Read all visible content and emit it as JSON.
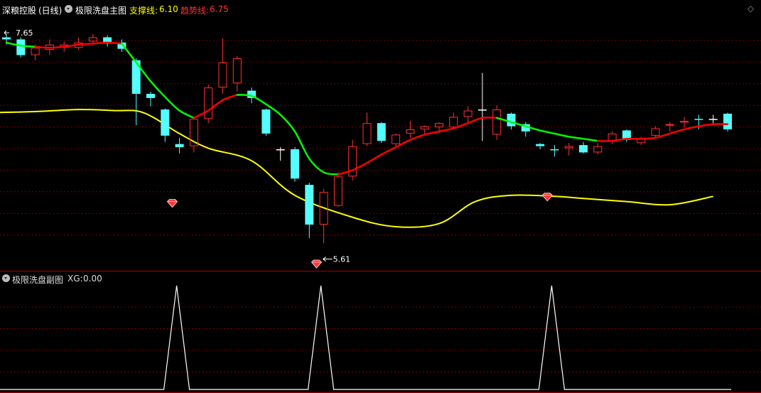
{
  "header": {
    "stock_name": "深粮控股",
    "period": "(日线)",
    "indicator_name": "极限洗盘主图",
    "support_label": "支撑线:",
    "support_value": "6.10",
    "trend_label": "趋势线:",
    "trend_value": "6.75"
  },
  "sub_header": {
    "indicator_name": "极限洗盘副图",
    "xg_label": "XG:",
    "xg_value": "0.00"
  },
  "icons": [
    "dropdown-circle-icon",
    "diamond-icon",
    "gem-marker-icon"
  ],
  "colors": {
    "background": "#000000",
    "grid": "#7a0000",
    "up_candle": "#ff3232",
    "down_candle": "#54ffff",
    "doji": "#ffffff",
    "support_line": "#ffff00",
    "trend_up": "#ff0000",
    "trend_down": "#00ff00",
    "signal_line": "#ffffff",
    "support_label": "#ffff00",
    "trend_label": "#ff3232"
  },
  "chart_data": [
    {
      "type": "candlestick",
      "name": "main",
      "ylim": [
        5.45,
        7.8
      ],
      "high_annotation": {
        "label": "7.65",
        "index": 0
      },
      "low_annotation": {
        "label": "5.61",
        "index": 22
      },
      "candles": [
        [
          7.62,
          7.6,
          7.65,
          7.55
        ],
        [
          7.6,
          7.45,
          7.62,
          7.43
        ],
        [
          7.45,
          7.52,
          7.55,
          7.4
        ],
        [
          7.5,
          7.55,
          7.6,
          7.45
        ],
        [
          7.52,
          7.55,
          7.58,
          7.48
        ],
        [
          7.52,
          7.57,
          7.62,
          7.5
        ],
        [
          7.58,
          7.62,
          7.65,
          7.55
        ],
        [
          7.62,
          7.56,
          7.64,
          7.53
        ],
        [
          7.57,
          7.51,
          7.6,
          7.48
        ],
        [
          7.4,
          7.08,
          7.42,
          6.78
        ],
        [
          7.08,
          7.04,
          7.1,
          6.96
        ],
        [
          6.93,
          6.68,
          6.94,
          6.62
        ],
        [
          6.6,
          6.57,
          6.66,
          6.51
        ],
        [
          6.58,
          6.84,
          6.86,
          6.52
        ],
        [
          6.84,
          7.14,
          7.17,
          6.8
        ],
        [
          7.14,
          7.38,
          7.61,
          7.08
        ],
        [
          7.18,
          7.42,
          7.44,
          7.1
        ],
        [
          7.11,
          7.04,
          7.14,
          6.99
        ],
        [
          6.93,
          6.7,
          6.94,
          6.68
        ],
        [
          6.55,
          6.55,
          6.57,
          6.44
        ],
        [
          6.55,
          6.27,
          6.57,
          6.24
        ],
        [
          6.21,
          5.83,
          6.23,
          5.7
        ],
        [
          5.83,
          6.14,
          6.17,
          5.65
        ],
        [
          6.01,
          6.29,
          6.33,
          6.0
        ],
        [
          6.29,
          6.58,
          6.64,
          6.25
        ],
        [
          6.6,
          6.8,
          6.9,
          6.58
        ],
        [
          6.8,
          6.63,
          6.81,
          6.61
        ],
        [
          6.6,
          6.69,
          6.7,
          6.58
        ],
        [
          6.7,
          6.74,
          6.82,
          6.66
        ],
        [
          6.74,
          6.77,
          6.78,
          6.68
        ],
        [
          6.76,
          6.8,
          6.81,
          6.7
        ],
        [
          6.76,
          6.86,
          6.9,
          6.74
        ],
        [
          6.86,
          6.92,
          6.96,
          6.8
        ],
        [
          6.93,
          6.93,
          7.28,
          6.63
        ],
        [
          6.69,
          6.93,
          6.97,
          6.64
        ],
        [
          6.89,
          6.77,
          6.9,
          6.74
        ],
        [
          6.79,
          6.72,
          6.81,
          6.67
        ],
        [
          6.6,
          6.58,
          6.61,
          6.55
        ],
        [
          6.55,
          6.54,
          6.59,
          6.48
        ],
        [
          6.56,
          6.58,
          6.61,
          6.49
        ],
        [
          6.59,
          6.52,
          6.62,
          6.51
        ],
        [
          6.52,
          6.58,
          6.61,
          6.5
        ],
        [
          6.63,
          6.7,
          6.72,
          6.6
        ],
        [
          6.73,
          6.64,
          6.74,
          6.62
        ],
        [
          6.61,
          6.65,
          6.67,
          6.59
        ],
        [
          6.68,
          6.75,
          6.77,
          6.66
        ],
        [
          6.78,
          6.79,
          6.81,
          6.72
        ],
        [
          6.81,
          6.82,
          6.86,
          6.76
        ],
        [
          6.84,
          6.83,
          6.88,
          6.74
        ],
        [
          6.84,
          6.84,
          6.88,
          6.8
        ],
        [
          6.89,
          6.74,
          6.9,
          6.72
        ]
      ],
      "trend_line": {
        "values": [
          7.57,
          7.54,
          7.53,
          7.52,
          7.53,
          7.55,
          7.56,
          7.57,
          7.56,
          7.38,
          7.2,
          7.05,
          6.92,
          6.85,
          6.92,
          7.02,
          7.07,
          7.06,
          6.98,
          6.88,
          6.72,
          6.46,
          6.33,
          6.31,
          6.35,
          6.42,
          6.5,
          6.57,
          6.64,
          6.69,
          6.72,
          6.75,
          6.8,
          6.85,
          6.85,
          6.81,
          6.77,
          6.73,
          6.7,
          6.67,
          6.65,
          6.63,
          6.63,
          6.65,
          6.65,
          6.66,
          6.7,
          6.74,
          6.77,
          6.79,
          6.79
        ],
        "segments": [
          {
            "color": "trend_down",
            "from": 0,
            "to": 2
          },
          {
            "color": "trend_up",
            "from": 2,
            "to": 8
          },
          {
            "color": "trend_down",
            "from": 8,
            "to": 13
          },
          {
            "color": "trend_up",
            "from": 13,
            "to": 16
          },
          {
            "color": "trend_down",
            "from": 16,
            "to": 23
          },
          {
            "color": "trend_up",
            "from": 23,
            "to": 34
          },
          {
            "color": "trend_down",
            "from": 34,
            "to": 41
          },
          {
            "color": "trend_up",
            "from": 41,
            "to": 50
          }
        ]
      },
      "support_line": {
        "x": [
          -1,
          2,
          5,
          7.5,
          9.5,
          12,
          14,
          17,
          20,
          24,
          27,
          30,
          32.5,
          35,
          38,
          40,
          43,
          46,
          49
        ],
        "values": [
          6.9,
          6.91,
          6.93,
          6.92,
          6.9,
          6.7,
          6.56,
          6.44,
          6.11,
          5.9,
          5.81,
          5.84,
          6.05,
          6.11,
          6.1,
          6.08,
          6.05,
          6.02,
          6.1
        ]
      },
      "markers": [
        {
          "index": 11.5,
          "value": 6.03
        },
        {
          "index": 21.5,
          "value": 5.45
        },
        {
          "index": 37.5,
          "value": 6.09
        }
      ]
    },
    {
      "type": "line",
      "name": "sub",
      "series": [
        {
          "values": [
            0,
            0,
            0,
            0,
            0,
            0,
            0,
            0,
            0,
            0,
            0,
            0,
            1,
            0,
            0,
            0,
            0,
            0,
            0,
            0,
            0,
            0,
            1,
            0,
            0,
            0,
            0,
            0,
            0,
            0,
            0,
            0,
            0,
            0,
            0,
            0,
            0,
            0,
            1,
            0,
            0,
            0,
            0,
            0,
            0,
            0,
            0,
            0,
            0,
            0,
            0
          ]
        }
      ],
      "ylim": [
        0,
        1
      ]
    }
  ]
}
